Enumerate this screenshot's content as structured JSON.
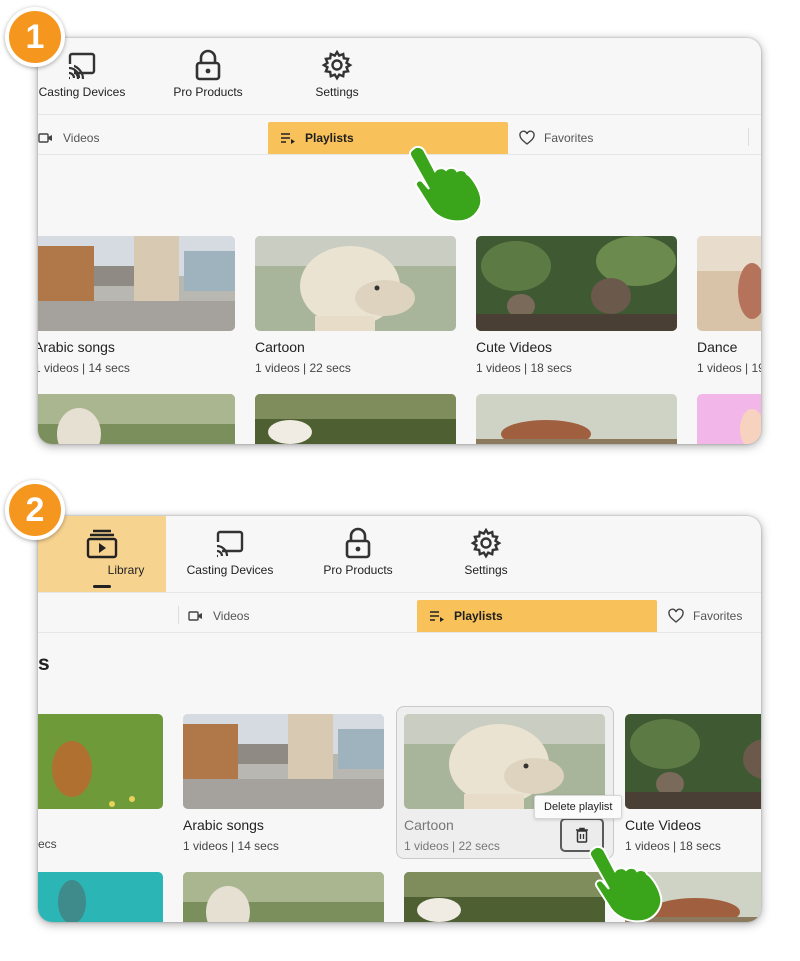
{
  "steps": [
    {
      "badge": "1",
      "nav": [
        {
          "label": "Casting Devices",
          "icon": "cast-icon"
        },
        {
          "label": "Pro Products",
          "icon": "lock-icon"
        },
        {
          "label": "Settings",
          "icon": "gear-icon"
        }
      ],
      "tabs": [
        {
          "label": "Videos",
          "icon": "video-camera-icon"
        },
        {
          "label": "Playlists",
          "icon": "playlist-icon",
          "active": true
        },
        {
          "label": "Favorites",
          "icon": "heart-icon"
        }
      ],
      "cards": [
        {
          "title": "Arabic songs",
          "meta": "1 videos | 14 secs"
        },
        {
          "title": "Cartoon",
          "meta": "1 videos | 22 secs"
        },
        {
          "title": "Cute Videos",
          "meta": "1 videos | 18 secs"
        },
        {
          "title": "Dance",
          "meta": "1 videos | 19"
        }
      ]
    },
    {
      "badge": "2",
      "nav": [
        {
          "label": "Library",
          "icon": "library-icon",
          "active": true
        },
        {
          "label": "Casting Devices",
          "icon": "cast-icon"
        },
        {
          "label": "Pro Products",
          "icon": "lock-icon"
        },
        {
          "label": "Settings",
          "icon": "gear-icon"
        }
      ],
      "tabs": [
        {
          "label": "Videos",
          "icon": "video-camera-icon"
        },
        {
          "label": "Playlists",
          "icon": "playlist-icon",
          "active": true
        },
        {
          "label": "Favorites",
          "icon": "heart-icon"
        }
      ],
      "heading_fragment": "s",
      "cards": [
        {
          "title": "",
          "meta": "ecs"
        },
        {
          "title": "Arabic songs",
          "meta": "1 videos | 14 secs"
        },
        {
          "title": "Cartoon",
          "meta": "1 videos | 22 secs",
          "hovered": true
        },
        {
          "title": "Cute Videos",
          "meta": "1 videos | 18 secs"
        }
      ],
      "tooltip": "Delete playlist",
      "delete_icon": "trash-icon"
    }
  ],
  "colors": {
    "badge": "#f5961f",
    "active_tab": "#f9c159",
    "active_nav": "#f7d390",
    "hand": "#3aa51b"
  }
}
